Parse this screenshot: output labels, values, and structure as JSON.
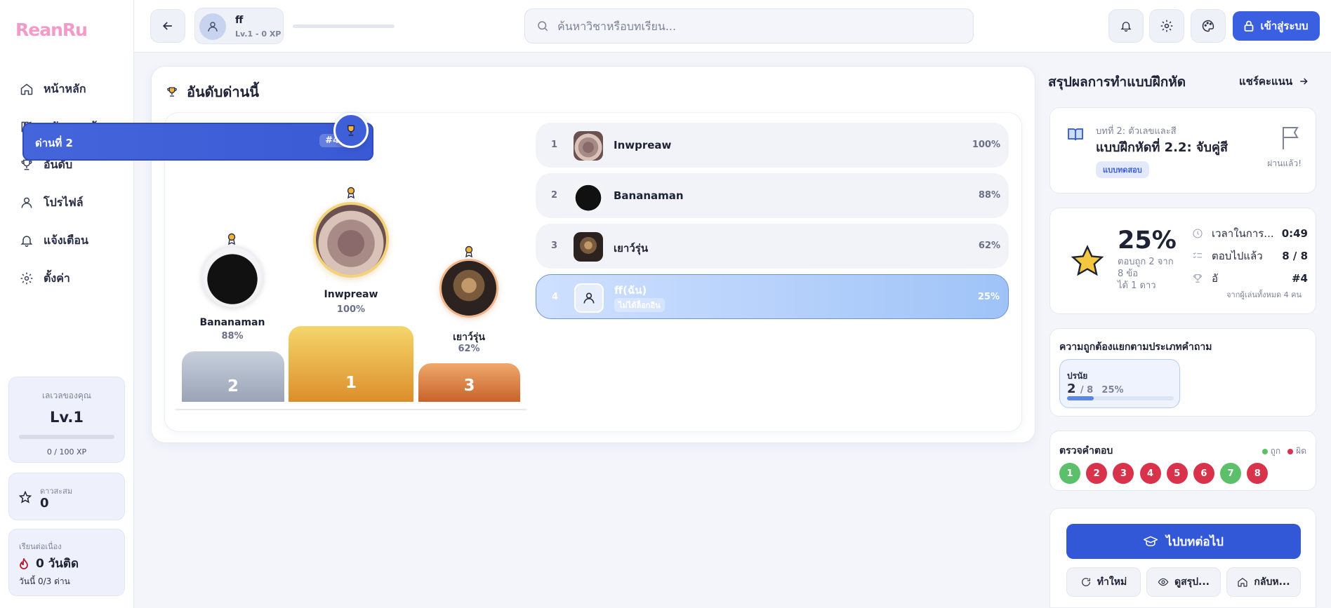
{
  "app": {
    "logo": "ReanRu"
  },
  "sidebar": {
    "items": [
      {
        "label": "หน้าหลัก",
        "icon": "home-icon"
      },
      {
        "label": "คลังความรู้",
        "icon": "library-icon"
      },
      {
        "label": "อันดับ",
        "icon": "trophy-icon"
      },
      {
        "label": "โปรไฟล์",
        "icon": "user-icon"
      },
      {
        "label": "แจ้งเตือน",
        "icon": "bell-icon"
      },
      {
        "label": "ตั้งค่า",
        "icon": "gear-icon"
      }
    ],
    "level": {
      "title": "เลเวลของคุณ",
      "value": "Lv.1",
      "xp": "0 / 100 XP",
      "progress": 0
    },
    "stars": {
      "title": "ดาวสะสม",
      "value": "0"
    },
    "streak": {
      "title": "เรียนต่อเนื่อง",
      "value": "0 วันติด",
      "sub": "วันนี้ 0/3 ด่าน"
    }
  },
  "topbar": {
    "user": {
      "name": "ff",
      "level": "Lv.1 - 0 XP"
    },
    "search_placeholder": "ค้นหาวิชาหรือบทเรียน...",
    "login_label": "เข้าสู่ระบบ"
  },
  "leaderboard": {
    "title": "อันดับด่านนี้",
    "stage_label": "ด่านที่ 2",
    "rank_badge": "#4 / 4",
    "podium": [
      {
        "place": "1",
        "name": "Inwpreaw",
        "pct": "100%"
      },
      {
        "place": "2",
        "name": "Bananaman",
        "pct": "88%"
      },
      {
        "place": "3",
        "name": "เยาว์รุ่น",
        "pct": "62%"
      }
    ],
    "rows": [
      {
        "rank": "1",
        "name": "Inwpreaw",
        "pct": "100%"
      },
      {
        "rank": "2",
        "name": "Bananaman",
        "pct": "88%"
      },
      {
        "rank": "3",
        "name": "เยาว์รุ่น",
        "pct": "62%"
      },
      {
        "rank": "4",
        "name": "ff(ฉัน)",
        "pct": "25%",
        "tag": "ไม่ได้ล็อกอิน"
      }
    ]
  },
  "summary": {
    "title": "สรุปผลการทำแบบฝึกหัด",
    "share_label": "แชร์คะแนน",
    "lesson": {
      "subtitle": "บทที่ 2: ตัวเลขและสี",
      "title": "แบบฝึกหัดที่ 2.2: จับคู่สี",
      "chip": "แบบทดสอบ",
      "passed": "ผ่านแล้ว!"
    },
    "score": {
      "percent": "25%",
      "detail_1": "ตอบถูก 2 จาก",
      "detail_2": "8 ข้อ",
      "detail_3": "ได้ 1 ดาว",
      "time_label": "เวลาในการ...",
      "time_value": "0:49",
      "answered_label": "ตอบไปแล้ว",
      "answered_value": "8 / 8",
      "rank_label": "อั",
      "rank_value": "#4",
      "rank_note": "จากผู้เล่นทั้งหมด 4 คน"
    },
    "accuracy": {
      "title": "ความถูกต้องแยกตามประเภทคำถาม",
      "category": "ปรนัย",
      "correct": "2",
      "total": "/ 8",
      "pct": "25%",
      "fraction": 0.25
    },
    "answers": {
      "title": "ตรวจคำตอบ",
      "legend_ok": "ถูก",
      "legend_bad": "ผิด",
      "items": [
        {
          "n": "1",
          "ok": true
        },
        {
          "n": "2",
          "ok": false
        },
        {
          "n": "3",
          "ok": false
        },
        {
          "n": "4",
          "ok": false
        },
        {
          "n": "5",
          "ok": false
        },
        {
          "n": "6",
          "ok": false
        },
        {
          "n": "7",
          "ok": true
        },
        {
          "n": "8",
          "ok": false
        }
      ]
    },
    "actions": {
      "next": "ไปบทต่อไป",
      "retry": "ทำใหม่",
      "view": "ดูสรุป...",
      "home": "กลับห..."
    }
  },
  "colors": {
    "accent": "#3a5fe0",
    "correct": "#5cbf6a",
    "wrong": "#d8334b"
  }
}
